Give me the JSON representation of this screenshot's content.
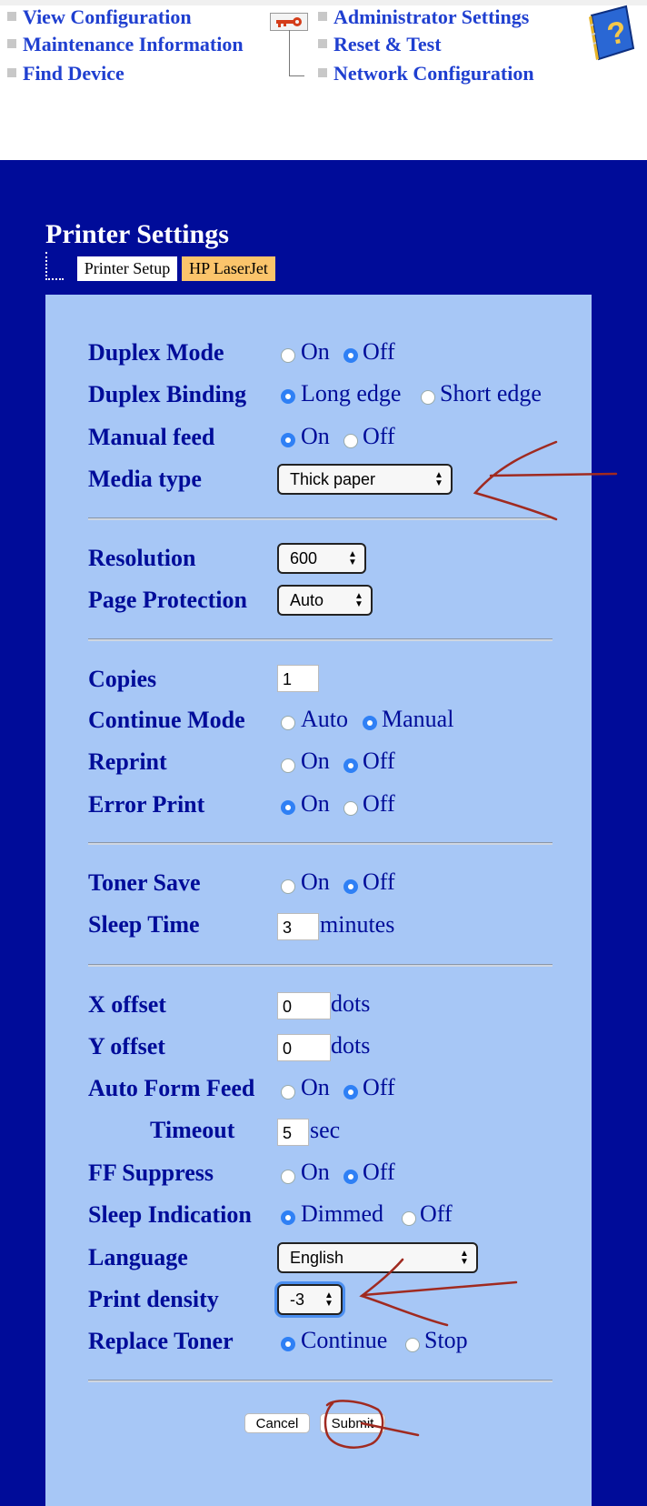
{
  "nav": {
    "left": [
      "View Configuration",
      "Maintenance Information",
      "Find Device"
    ],
    "right": [
      "Administrator Settings",
      "Reset & Test",
      "Network Configuration"
    ]
  },
  "page": {
    "title": "Printer Settings",
    "tabs": [
      "Printer Setup",
      "HP LaserJet"
    ]
  },
  "settings": {
    "duplex_mode": {
      "label": "Duplex Mode",
      "options": [
        "On",
        "Off"
      ],
      "selected": "Off"
    },
    "duplex_binding": {
      "label": "Duplex Binding",
      "options": [
        "Long edge",
        "Short edge"
      ],
      "selected": "Long edge"
    },
    "manual_feed": {
      "label": "Manual feed",
      "options": [
        "On",
        "Off"
      ],
      "selected": "On"
    },
    "media_type": {
      "label": "Media type",
      "value": "Thick paper"
    },
    "resolution": {
      "label": "Resolution",
      "value": "600"
    },
    "page_protection": {
      "label": "Page Protection",
      "value": "Auto"
    },
    "copies": {
      "label": "Copies",
      "value": "1"
    },
    "continue_mode": {
      "label": "Continue Mode",
      "options": [
        "Auto",
        "Manual"
      ],
      "selected": "Manual"
    },
    "reprint": {
      "label": "Reprint",
      "options": [
        "On",
        "Off"
      ],
      "selected": "Off"
    },
    "error_print": {
      "label": "Error Print",
      "options": [
        "On",
        "Off"
      ],
      "selected": "On"
    },
    "toner_save": {
      "label": "Toner Save",
      "options": [
        "On",
        "Off"
      ],
      "selected": "Off"
    },
    "sleep_time": {
      "label": "Sleep Time",
      "value": "3",
      "unit": "minutes"
    },
    "x_offset": {
      "label": "X offset",
      "value": "0",
      "unit": "dots"
    },
    "y_offset": {
      "label": "Y offset",
      "value": "0",
      "unit": "dots"
    },
    "auto_form_feed": {
      "label": "Auto Form Feed",
      "options": [
        "On",
        "Off"
      ],
      "selected": "Off"
    },
    "timeout": {
      "label": "Timeout",
      "value": "5",
      "unit": "sec"
    },
    "ff_suppress": {
      "label": "FF Suppress",
      "options": [
        "On",
        "Off"
      ],
      "selected": "Off"
    },
    "sleep_indication": {
      "label": "Sleep Indication",
      "options": [
        "Dimmed",
        "Off"
      ],
      "selected": "Dimmed"
    },
    "language": {
      "label": "Language",
      "value": "English"
    },
    "print_density": {
      "label": "Print density",
      "value": "-3"
    },
    "replace_toner": {
      "label": "Replace Toner",
      "options": [
        "Continue",
        "Stop"
      ],
      "selected": "Continue"
    }
  },
  "buttons": {
    "cancel": "Cancel",
    "submit": "Submit"
  },
  "colors": {
    "background": "#000c99",
    "panel": "#a7c7f6",
    "label": "#000c99",
    "link": "#1f3fd0",
    "tab_active": "#fbc46b",
    "annotation": "#a02a20"
  },
  "icons": [
    "key-icon",
    "help-book-icon",
    "chevron-updown-icon"
  ]
}
